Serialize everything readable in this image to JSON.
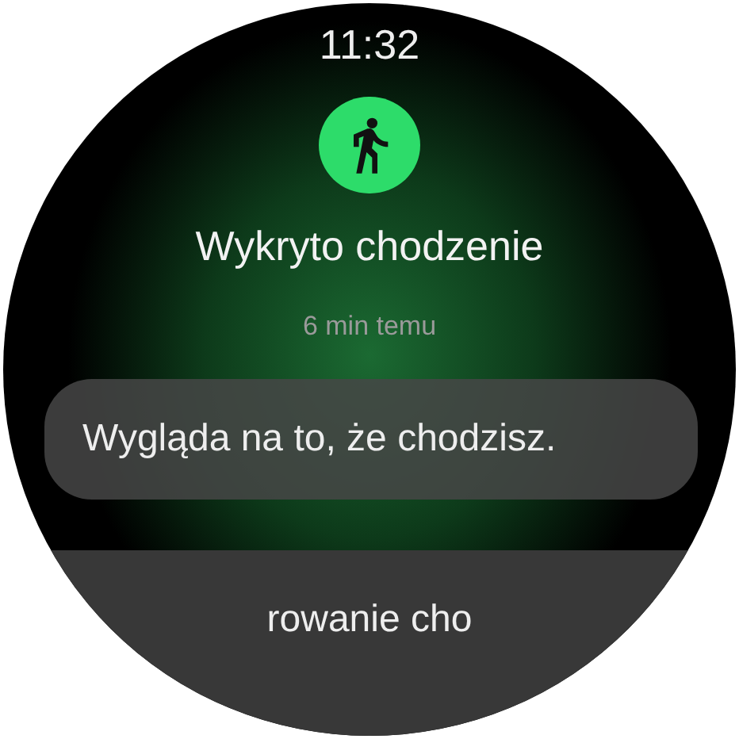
{
  "status_bar": {
    "time": "11:32"
  },
  "notification": {
    "title": "Wykryto chodzenie",
    "time_ago": "6 min temu",
    "message": "Wygląda na to, że chodzisz."
  },
  "next_card": {
    "label": "rowanie cho"
  }
}
